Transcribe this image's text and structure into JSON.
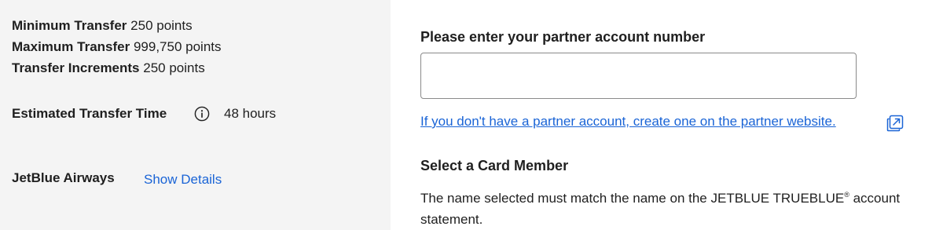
{
  "transfer_details": {
    "minimum": {
      "label": "Minimum Transfer",
      "value": "250 points"
    },
    "maximum": {
      "label": "Maximum Transfer",
      "value": "999,750 points"
    },
    "increments": {
      "label": "Transfer Increments",
      "value": "250 points"
    },
    "estimated_time": {
      "label": "Estimated Transfer Time",
      "value": "48 hours",
      "icon": "info-icon"
    }
  },
  "partner": {
    "name": "JetBlue Airways",
    "show_details_label": "Show Details"
  },
  "account_form": {
    "label": "Please enter your partner account number",
    "input_value": "",
    "input_placeholder": "",
    "create_link_text": "If you don't have a partner account, create one on the partner website.",
    "link_icon": "external-link-icon"
  },
  "card_member": {
    "title": "Select a Card Member",
    "description_prefix": "The name selected must match the name on the JETBLUE TRUEBLUE",
    "description_mark": "®",
    "description_suffix": "account statement."
  },
  "colors": {
    "link": "#1a64d6",
    "left_panel_bg": "#f4f4f4",
    "text": "#1f1f1f",
    "input_border": "#8a8a8a"
  }
}
